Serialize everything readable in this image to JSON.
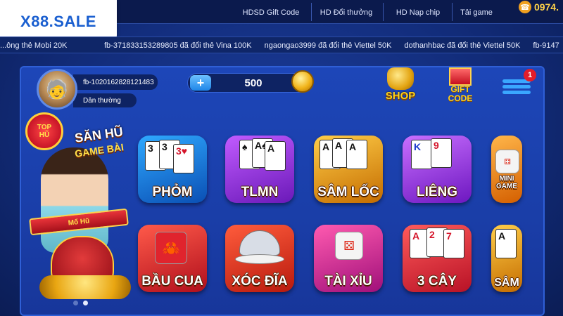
{
  "logo": {
    "text": "X88.SALE"
  },
  "topnav": {
    "items": [
      {
        "label": "HDSD Gift Code"
      },
      {
        "label": "HD Đổi thưởng"
      },
      {
        "label": "HD Nạp chip"
      },
      {
        "label": "Tải game"
      }
    ],
    "phone": "0974.",
    "phone_icon": "phone-icon"
  },
  "ticker": {
    "items": [
      "...ông thẻ Mobi 20K",
      "fb-371833153289805 đã đổi thẻ Vina 100K",
      "ngaongao3999 đã đổi thẻ Viettel 50K",
      "dothanhbac đã đổi thẻ Viettel 50K",
      "fb-9147"
    ]
  },
  "user": {
    "id": "fb-1020162828121483",
    "rank": "Dân thường",
    "balance": "500"
  },
  "actions": {
    "add_icon": "plus-icon",
    "shop_label": "SHOP",
    "gift_label_1": "GIFT",
    "gift_label_2": "CODE",
    "menu_badge": "1"
  },
  "promo": {
    "top_hu_1": "TOP",
    "top_hu_2": "HŨ",
    "san_hu": "SĂN HŨ",
    "game_bai": "GAME BÀI",
    "mo_hu": "Mổ Hũ"
  },
  "games": {
    "row1": [
      {
        "name": "PHỎM"
      },
      {
        "name": "TLMN"
      },
      {
        "name": "SÂM LỐC"
      },
      {
        "name": "LIÊNG"
      },
      {
        "name": "MINI GAME"
      }
    ],
    "row2": [
      {
        "name": "BẦU CUA"
      },
      {
        "name": "XÓC ĐĨA"
      },
      {
        "name": "TÀI XỈU"
      },
      {
        "name": "3 CÂY"
      },
      {
        "name": "SÂM"
      }
    ]
  },
  "colors": {
    "background": "#122c7a",
    "panel": "#1a3ea8",
    "gold": "#ffd21a",
    "accent": "#3aa7ff"
  }
}
